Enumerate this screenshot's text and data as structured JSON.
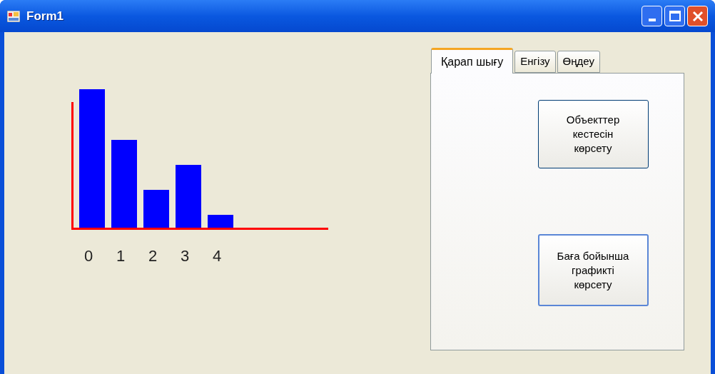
{
  "window": {
    "title": "Form1"
  },
  "chart": {
    "x_labels": [
      "0",
      "1",
      "2",
      "3",
      "4"
    ]
  },
  "tabs": [
    {
      "label": "Қарап шығу",
      "selected": true
    },
    {
      "label": "Енгізу",
      "selected": false
    },
    {
      "label": "Өңдеу",
      "selected": false
    }
  ],
  "buttons": [
    {
      "label": "Объекттер\nкестесін\nкөрсету",
      "focused": false
    },
    {
      "label": "Баға бойынша\nграфикті\nкөрсету",
      "focused": true
    }
  ]
}
